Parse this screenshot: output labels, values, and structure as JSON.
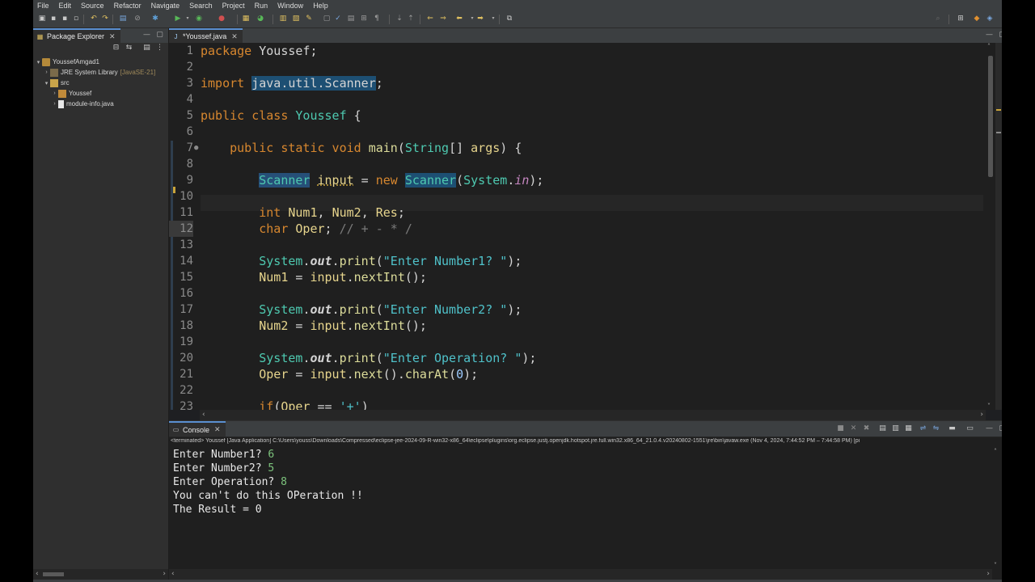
{
  "menu": [
    "File",
    "Edit",
    "Source",
    "Refactor",
    "Navigate",
    "Search",
    "Project",
    "Run",
    "Window",
    "Help"
  ],
  "package_explorer": {
    "title": "Package Explorer",
    "tree": [
      {
        "label": "YoussefAmgad1",
        "arrow": "▾",
        "depth": 0,
        "icon": "project-icon"
      },
      {
        "label": "JRE System Library",
        "suffix": "[JavaSE-21]",
        "arrow": "›",
        "depth": 1,
        "icon": "library-icon"
      },
      {
        "label": "src",
        "arrow": "▾",
        "depth": 1,
        "icon": "source-folder-icon"
      },
      {
        "label": "Youssef",
        "arrow": "›",
        "depth": 2,
        "icon": "package-icon"
      },
      {
        "label": "module-info.java",
        "arrow": "›",
        "depth": 2,
        "icon": "java-file-icon"
      }
    ]
  },
  "editor": {
    "tab_label": "*Youssef.java",
    "line_numbers": [
      "1",
      "2",
      "3",
      "4",
      "5",
      "6",
      "7",
      "8",
      "9",
      "10",
      "11",
      "12",
      "13",
      "14",
      "15",
      "16",
      "17",
      "18",
      "19",
      "20",
      "21",
      "22",
      "23"
    ],
    "line_markers": {
      "7": "●"
    }
  },
  "console": {
    "tab_label": "Console",
    "status": "<terminated> Youssef [Java Application] C:\\Users\\youss\\Downloads\\Compressed\\eclipse-jee-2024-09-R-win32-x86_64\\eclipse\\plugins\\org.eclipse.justj.openjdk.hotspot.jre.full.win32.x86_64_21.0.4.v20240802-1551\\jre\\bin\\javaw.exe (Nov 4, 2024, 7:44:52 PM – 7:44:58 PM) [pi",
    "lines": [
      {
        "prompt": "Enter Number1? ",
        "input": "6"
      },
      {
        "prompt": "Enter Number2? ",
        "input": "5"
      },
      {
        "prompt": "Enter Operation? ",
        "input": "8"
      },
      {
        "prompt": "You can't do this OPeration !!",
        "input": ""
      },
      {
        "prompt": "The Result = 0",
        "input": ""
      }
    ]
  },
  "colors": {
    "accent": "#5a8fd0",
    "console_input": "#7dc47d",
    "editor_bg": "#1f1f1f"
  }
}
